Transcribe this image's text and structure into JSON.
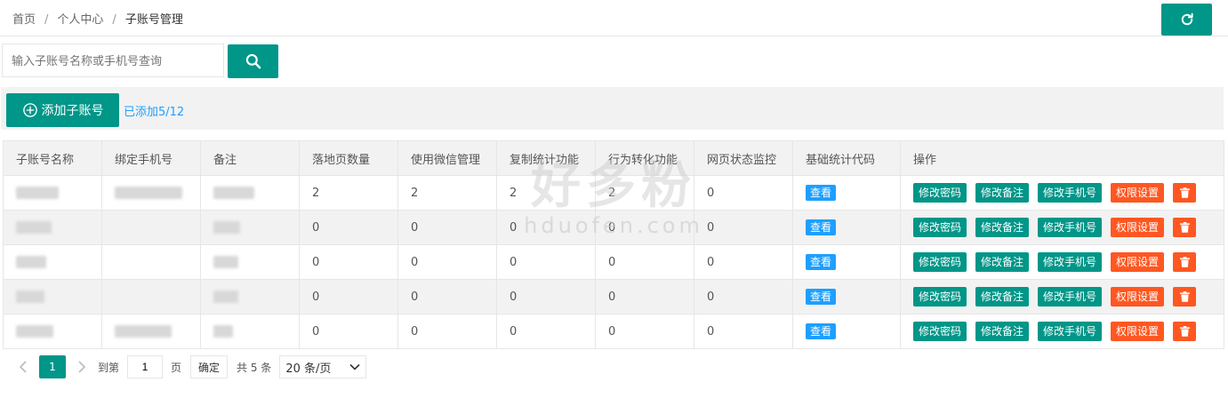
{
  "breadcrumb": [
    {
      "label": "首页"
    },
    {
      "label": "个人中心"
    },
    {
      "label": "子账号管理"
    }
  ],
  "breadcrumb_separator": "/",
  "refresh_icon": "refresh-icon",
  "search": {
    "placeholder": "输入子账号名称或手机号查询",
    "icon": "search-icon"
  },
  "toolbar": {
    "add_label": "添加子账号",
    "add_icon": "plus-circle-icon",
    "added_text": "已添加5/12"
  },
  "table": {
    "columns": [
      "子账号名称",
      "绑定手机号",
      "备注",
      "落地页数量",
      "使用微信管理",
      "复制统计功能",
      "行为转化功能",
      "网页状态监控",
      "基础统计代码",
      "操作"
    ],
    "rows": [
      {
        "landing": "2",
        "wechat": "2",
        "copy": "2",
        "behavior": "2",
        "monitor": "0"
      },
      {
        "landing": "0",
        "wechat": "0",
        "copy": "0",
        "behavior": "0",
        "monitor": "0"
      },
      {
        "landing": "0",
        "wechat": "0",
        "copy": "0",
        "behavior": "0",
        "monitor": "0"
      },
      {
        "landing": "0",
        "wechat": "0",
        "copy": "0",
        "behavior": "0",
        "monitor": "0"
      },
      {
        "landing": "0",
        "wechat": "0",
        "copy": "0",
        "behavior": "0",
        "monitor": "0"
      }
    ],
    "view_label": "查看",
    "actions": {
      "change_password": "修改密码",
      "change_remark": "修改备注",
      "change_phone": "修改手机号",
      "permissions": "权限设置",
      "delete_icon": "trash-icon"
    }
  },
  "pagination": {
    "current_page": "1",
    "goto_label": "到第",
    "page_input_value": "1",
    "page_unit": "页",
    "confirm_label": "确定",
    "total_text": "共 5 条",
    "page_size": "20 条/页"
  },
  "watermark": {
    "cn": "好多粉",
    "en": "hduofen.com"
  },
  "colors": {
    "primary": "#009688",
    "info": "#1e9fff",
    "danger": "#ff5722"
  }
}
